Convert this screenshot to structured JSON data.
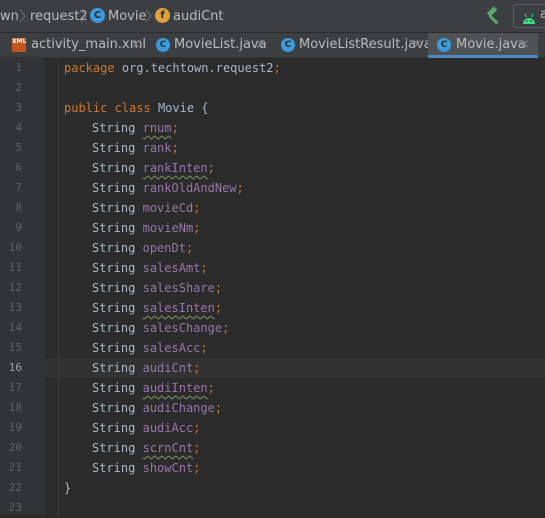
{
  "breadcrumb": {
    "items": [
      "wn",
      "request2",
      "Movie",
      "audiCnt"
    ],
    "class_badge": "C",
    "field_badge": "f"
  },
  "toolbar": {
    "build_icon": "hammer-icon",
    "run_config_label": "a"
  },
  "tabs": [
    {
      "label": "activity_main.xml",
      "icon": "xml-file-icon",
      "active": false
    },
    {
      "label": "MovieList.java",
      "icon": "class-icon",
      "active": false
    },
    {
      "label": "MovieListResult.java",
      "icon": "class-icon",
      "active": false
    },
    {
      "label": "Movie.java",
      "icon": "class-icon",
      "active": true
    }
  ],
  "tab_close": "×",
  "tab_icon_xml_text": "XML",
  "tab_icon_class_text": "C",
  "editor": {
    "current_line": 16,
    "line_numbers": [
      "1",
      "2",
      "3",
      "4",
      "5",
      "6",
      "7",
      "8",
      "9",
      "10",
      "11",
      "12",
      "13",
      "14",
      "15",
      "16",
      "17",
      "18",
      "19",
      "20",
      "21",
      "22",
      "23"
    ],
    "package_line": {
      "keyword": "package",
      "name": "org.techtown.request2"
    },
    "class_line": {
      "keywords": "public class",
      "name": "Movie",
      "brace": "{"
    },
    "field_type": "String",
    "fields": [
      "rnum",
      "rank",
      "rankInten",
      "rankOldAndNew",
      "movieCd",
      "movieNm",
      "openDt",
      "salesAmt",
      "salesShare",
      "salesInten",
      "salesChange",
      "salesAcc",
      "audiCnt",
      "audiInten",
      "audiChange",
      "audiAcc",
      "scrnCnt",
      "showCnt"
    ],
    "closing_brace": "}",
    "semicolon": ";"
  },
  "colors": {
    "background": "#2b2b2b",
    "keyword": "#cc7832",
    "field": "#9876aa",
    "text": "#a9b7c6",
    "accent": "#4a88c7"
  }
}
